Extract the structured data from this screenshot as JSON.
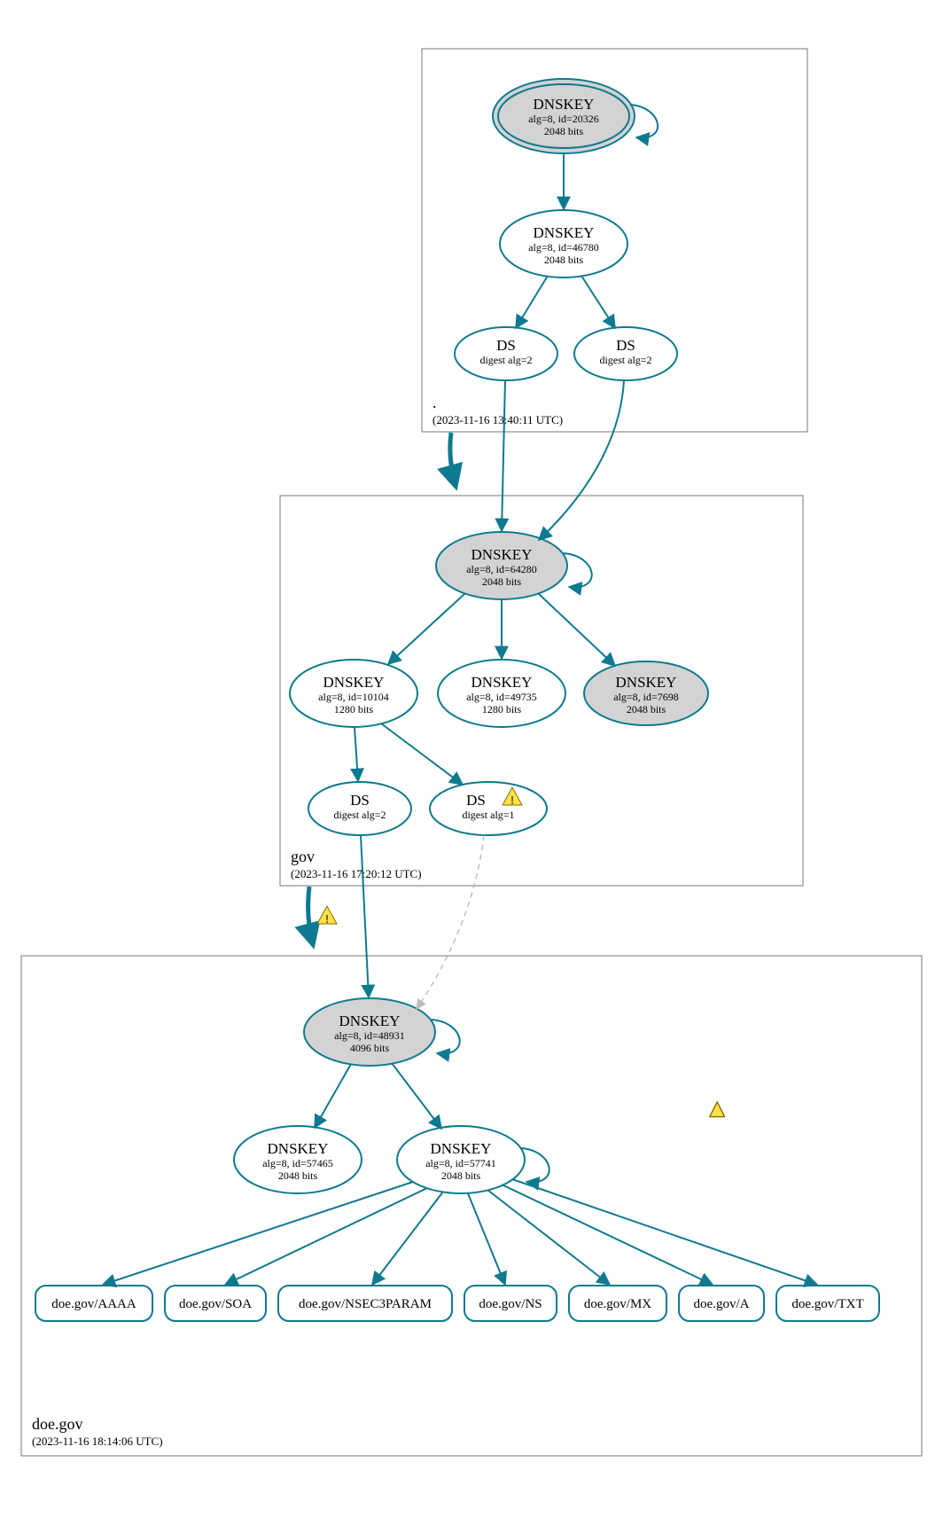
{
  "colors": {
    "teal": "#0e7a8f",
    "node_gray": "#d3d3d3",
    "box_stroke": "#777777"
  },
  "zones": {
    "root": {
      "name": ".",
      "timestamp": "(2023-11-16 13:40:11 UTC)"
    },
    "gov": {
      "name": "gov",
      "timestamp": "(2023-11-16 17:20:12 UTC)"
    },
    "doe": {
      "name": "doe.gov",
      "timestamp": "(2023-11-16 18:14:06 UTC)"
    }
  },
  "nodes": {
    "root_ksk": {
      "title": "DNSKEY",
      "line2": "alg=8, id=20326",
      "line3": "2048 bits"
    },
    "root_zsk": {
      "title": "DNSKEY",
      "line2": "alg=8, id=46780",
      "line3": "2048 bits"
    },
    "root_ds1": {
      "title": "DS",
      "line2": "digest alg=2"
    },
    "root_ds2": {
      "title": "DS",
      "line2": "digest alg=2"
    },
    "gov_ksk": {
      "title": "DNSKEY",
      "line2": "alg=8, id=64280",
      "line3": "2048 bits"
    },
    "gov_zsk1": {
      "title": "DNSKEY",
      "line2": "alg=8, id=10104",
      "line3": "1280 bits"
    },
    "gov_zsk2": {
      "title": "DNSKEY",
      "line2": "alg=8, id=49735",
      "line3": "1280 bits"
    },
    "gov_zsk3": {
      "title": "DNSKEY",
      "line2": "alg=8, id=7698",
      "line3": "2048 bits"
    },
    "gov_ds1": {
      "title": "DS",
      "line2": "digest alg=2"
    },
    "gov_ds2": {
      "title": "DS",
      "line2": "digest alg=1"
    },
    "doe_ksk": {
      "title": "DNSKEY",
      "line2": "alg=8, id=48931",
      "line3": "4096 bits"
    },
    "doe_zsk1": {
      "title": "DNSKEY",
      "line2": "alg=8, id=57465",
      "line3": "2048 bits"
    },
    "doe_zsk2": {
      "title": "DNSKEY",
      "line2": "alg=8, id=57741",
      "line3": "2048 bits"
    }
  },
  "rrsets": {
    "aaaa": "doe.gov/AAAA",
    "soa": "doe.gov/SOA",
    "nsec3param": "doe.gov/NSEC3PARAM",
    "ns": "doe.gov/NS",
    "mx": "doe.gov/MX",
    "a": "doe.gov/A",
    "txt": "doe.gov/TXT"
  }
}
